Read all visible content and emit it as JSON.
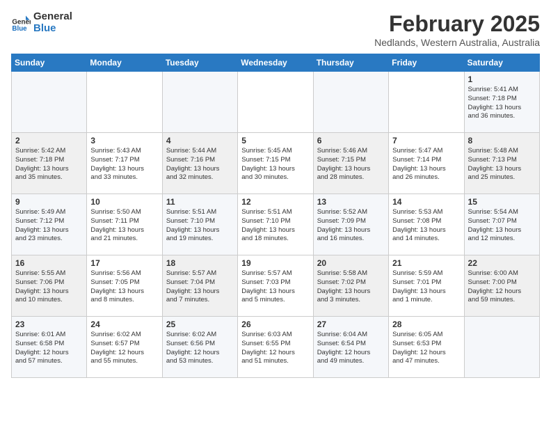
{
  "header": {
    "logo_line1": "General",
    "logo_line2": "Blue",
    "month_title": "February 2025",
    "location": "Nedlands, Western Australia, Australia"
  },
  "days_of_week": [
    "Sunday",
    "Monday",
    "Tuesday",
    "Wednesday",
    "Thursday",
    "Friday",
    "Saturday"
  ],
  "weeks": [
    {
      "days": [
        {
          "num": "",
          "info": ""
        },
        {
          "num": "",
          "info": ""
        },
        {
          "num": "",
          "info": ""
        },
        {
          "num": "",
          "info": ""
        },
        {
          "num": "",
          "info": ""
        },
        {
          "num": "",
          "info": ""
        },
        {
          "num": "1",
          "info": "Sunrise: 5:41 AM\nSunset: 7:18 PM\nDaylight: 13 hours\nand 36 minutes."
        }
      ]
    },
    {
      "days": [
        {
          "num": "2",
          "info": "Sunrise: 5:42 AM\nSunset: 7:18 PM\nDaylight: 13 hours\nand 35 minutes."
        },
        {
          "num": "3",
          "info": "Sunrise: 5:43 AM\nSunset: 7:17 PM\nDaylight: 13 hours\nand 33 minutes."
        },
        {
          "num": "4",
          "info": "Sunrise: 5:44 AM\nSunset: 7:16 PM\nDaylight: 13 hours\nand 32 minutes."
        },
        {
          "num": "5",
          "info": "Sunrise: 5:45 AM\nSunset: 7:15 PM\nDaylight: 13 hours\nand 30 minutes."
        },
        {
          "num": "6",
          "info": "Sunrise: 5:46 AM\nSunset: 7:15 PM\nDaylight: 13 hours\nand 28 minutes."
        },
        {
          "num": "7",
          "info": "Sunrise: 5:47 AM\nSunset: 7:14 PM\nDaylight: 13 hours\nand 26 minutes."
        },
        {
          "num": "8",
          "info": "Sunrise: 5:48 AM\nSunset: 7:13 PM\nDaylight: 13 hours\nand 25 minutes."
        }
      ]
    },
    {
      "days": [
        {
          "num": "9",
          "info": "Sunrise: 5:49 AM\nSunset: 7:12 PM\nDaylight: 13 hours\nand 23 minutes."
        },
        {
          "num": "10",
          "info": "Sunrise: 5:50 AM\nSunset: 7:11 PM\nDaylight: 13 hours\nand 21 minutes."
        },
        {
          "num": "11",
          "info": "Sunrise: 5:51 AM\nSunset: 7:10 PM\nDaylight: 13 hours\nand 19 minutes."
        },
        {
          "num": "12",
          "info": "Sunrise: 5:51 AM\nSunset: 7:10 PM\nDaylight: 13 hours\nand 18 minutes."
        },
        {
          "num": "13",
          "info": "Sunrise: 5:52 AM\nSunset: 7:09 PM\nDaylight: 13 hours\nand 16 minutes."
        },
        {
          "num": "14",
          "info": "Sunrise: 5:53 AM\nSunset: 7:08 PM\nDaylight: 13 hours\nand 14 minutes."
        },
        {
          "num": "15",
          "info": "Sunrise: 5:54 AM\nSunset: 7:07 PM\nDaylight: 13 hours\nand 12 minutes."
        }
      ]
    },
    {
      "days": [
        {
          "num": "16",
          "info": "Sunrise: 5:55 AM\nSunset: 7:06 PM\nDaylight: 13 hours\nand 10 minutes."
        },
        {
          "num": "17",
          "info": "Sunrise: 5:56 AM\nSunset: 7:05 PM\nDaylight: 13 hours\nand 8 minutes."
        },
        {
          "num": "18",
          "info": "Sunrise: 5:57 AM\nSunset: 7:04 PM\nDaylight: 13 hours\nand 7 minutes."
        },
        {
          "num": "19",
          "info": "Sunrise: 5:57 AM\nSunset: 7:03 PM\nDaylight: 13 hours\nand 5 minutes."
        },
        {
          "num": "20",
          "info": "Sunrise: 5:58 AM\nSunset: 7:02 PM\nDaylight: 13 hours\nand 3 minutes."
        },
        {
          "num": "21",
          "info": "Sunrise: 5:59 AM\nSunset: 7:01 PM\nDaylight: 13 hours\nand 1 minute."
        },
        {
          "num": "22",
          "info": "Sunrise: 6:00 AM\nSunset: 7:00 PM\nDaylight: 12 hours\nand 59 minutes."
        }
      ]
    },
    {
      "days": [
        {
          "num": "23",
          "info": "Sunrise: 6:01 AM\nSunset: 6:58 PM\nDaylight: 12 hours\nand 57 minutes."
        },
        {
          "num": "24",
          "info": "Sunrise: 6:02 AM\nSunset: 6:57 PM\nDaylight: 12 hours\nand 55 minutes."
        },
        {
          "num": "25",
          "info": "Sunrise: 6:02 AM\nSunset: 6:56 PM\nDaylight: 12 hours\nand 53 minutes."
        },
        {
          "num": "26",
          "info": "Sunrise: 6:03 AM\nSunset: 6:55 PM\nDaylight: 12 hours\nand 51 minutes."
        },
        {
          "num": "27",
          "info": "Sunrise: 6:04 AM\nSunset: 6:54 PM\nDaylight: 12 hours\nand 49 minutes."
        },
        {
          "num": "28",
          "info": "Sunrise: 6:05 AM\nSunset: 6:53 PM\nDaylight: 12 hours\nand 47 minutes."
        },
        {
          "num": "",
          "info": ""
        }
      ]
    }
  ]
}
